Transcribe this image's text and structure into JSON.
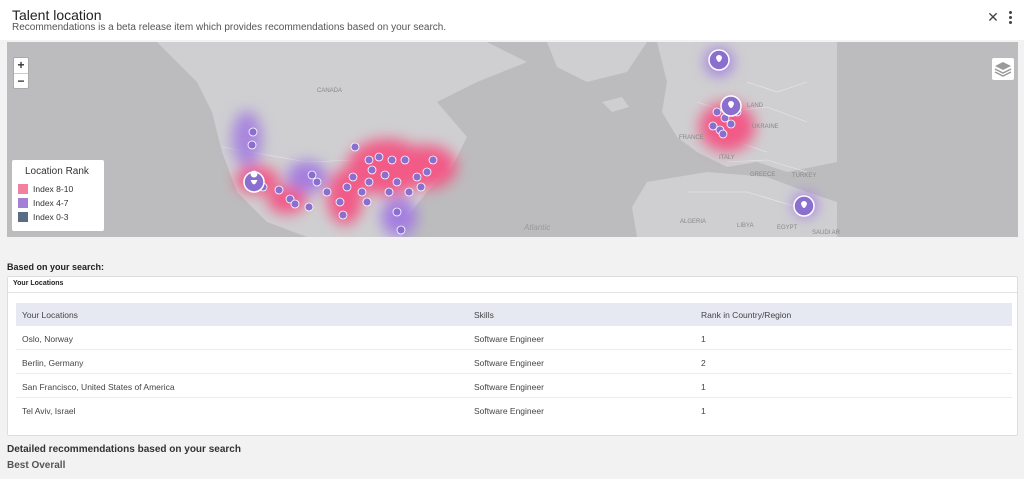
{
  "header": {
    "title": "Talent location",
    "subtitle": "Recommendations is a beta release item which provides recommendations based on your search.",
    "close_label": "✕"
  },
  "map": {
    "zoom_in": "+",
    "zoom_out": "−",
    "labels": {
      "canada": "CANADA",
      "atlantic": "Atlantic",
      "ukraine": "UKRAINE",
      "land": "LAND",
      "france": "FRANCE",
      "italy": "ITALY",
      "greece": "GREECE",
      "turkey": "TURKEY",
      "algeria": "ALGERIA",
      "libya": "LIBYA",
      "egypt": "EGYPT",
      "saudi": "SAUDI AR"
    },
    "legend": {
      "title": "Location Rank",
      "items": [
        {
          "label": "Index 8-10",
          "color": "#f2819f"
        },
        {
          "label": "Index 4-7",
          "color": "#a37fd6"
        },
        {
          "label": "Index 0-3",
          "color": "#5a6b86"
        }
      ]
    },
    "colors": {
      "heat_pink": "#f25a87",
      "heat_purple": "#a47ee0",
      "marker": "#8a6fcf"
    }
  },
  "search": {
    "heading": "Based on your search:",
    "card_title": "Your Locations",
    "columns": [
      "Your Locations",
      "Skills",
      "Rank in Country/Region"
    ],
    "rows": [
      {
        "location": "Oslo, Norway",
        "skill": "Software Engineer",
        "rank": "1"
      },
      {
        "location": "Berlin, Germany",
        "skill": "Software Engineer",
        "rank": "2"
      },
      {
        "location": "San Francisco, United States of America",
        "skill": "Software Engineer",
        "rank": "1"
      },
      {
        "location": "Tel Aviv, Israel",
        "skill": "Software Engineer",
        "rank": "1"
      }
    ]
  },
  "detailed": {
    "heading": "Detailed recommendations based on your search",
    "subheading": "Best Overall"
  }
}
